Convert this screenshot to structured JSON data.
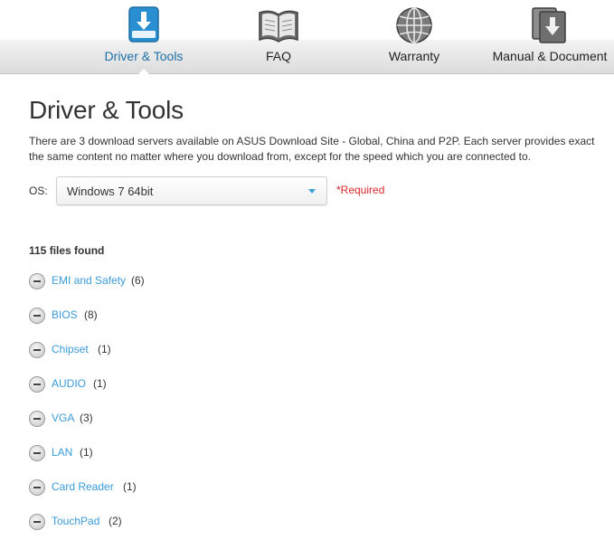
{
  "tabs": [
    {
      "label": "Driver & Tools",
      "icon": "download-tray-icon",
      "active": true
    },
    {
      "label": "FAQ",
      "icon": "open-book-icon",
      "active": false
    },
    {
      "label": "Warranty",
      "icon": "globe-icon",
      "active": false
    },
    {
      "label": "Manual & Document",
      "icon": "document-download-icon",
      "active": false
    }
  ],
  "page": {
    "title": "Driver & Tools",
    "description": "There are 3 download servers available on ASUS Download Site - Global, China and P2P. Each server provides exact the same content no matter where you download from, except for the speed which you are connected to."
  },
  "os": {
    "label": "OS:",
    "selected": "Windows 7 64bit",
    "required_text": "*Required"
  },
  "files_found": "115 files found",
  "categories": [
    {
      "name": "EMI and Safety",
      "count": "(6)"
    },
    {
      "name": "BIOS",
      "count": "(8)"
    },
    {
      "name": "Chipset",
      "count": "(1)"
    },
    {
      "name": "AUDIO",
      "count": "(1)"
    },
    {
      "name": "VGA",
      "count": "(3)"
    },
    {
      "name": "LAN",
      "count": "(1)"
    },
    {
      "name": "Card Reader",
      "count": "(1)"
    },
    {
      "name": "TouchPad",
      "count": "(2)"
    }
  ],
  "colors": {
    "active_tab": "#1d6fa8",
    "link": "#3a9bd6",
    "required": "#d9262b",
    "dropdown_caret": "#39a0d6"
  }
}
